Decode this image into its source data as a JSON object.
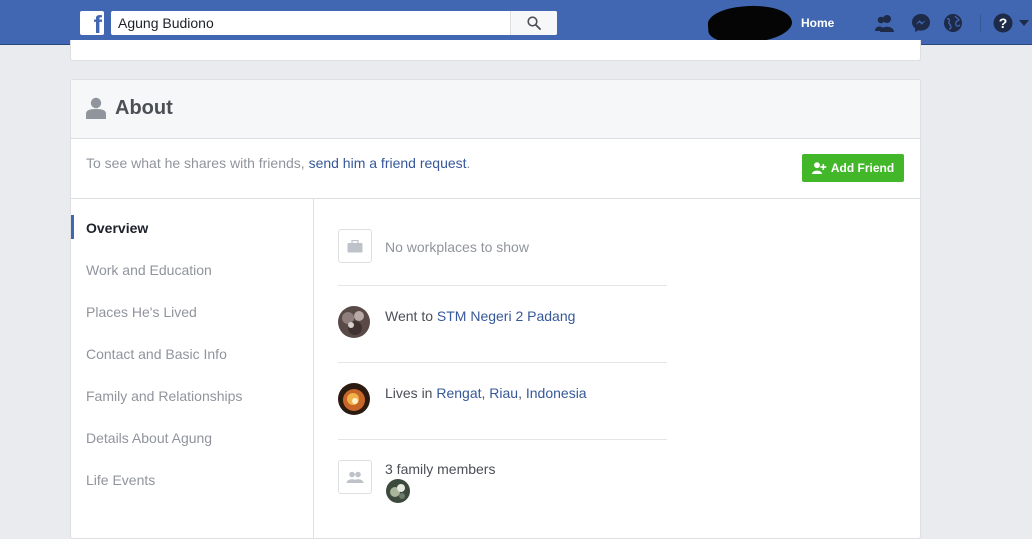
{
  "topbar": {
    "logo_letter": "f",
    "search_value": "Agung Budiono",
    "home_label": "Home"
  },
  "about": {
    "title": "About",
    "notice_prefix": "To see what he shares with friends, ",
    "notice_link": "send him a friend request",
    "notice_suffix": ".",
    "add_friend_label": "Add Friend"
  },
  "nav": {
    "items": [
      {
        "label": "Overview"
      },
      {
        "label": "Work and Education"
      },
      {
        "label": "Places He's Lived"
      },
      {
        "label": "Contact and Basic Info"
      },
      {
        "label": "Family and Relationships"
      },
      {
        "label": "Details About Agung"
      },
      {
        "label": "Life Events"
      }
    ]
  },
  "overview": {
    "work_text": "No workplaces to show",
    "school_prefix": "Went to ",
    "school_link": "STM Negeri 2 Padang",
    "lives_prefix": "Lives in ",
    "lives_city": "Rengat",
    "lives_sep1": ", ",
    "lives_region": "Riau",
    "lives_sep2": ", ",
    "lives_country": "Indonesia",
    "family_text": "3 family members"
  },
  "colors": {
    "brand_blue": "#4267b2",
    "add_friend_green": "#42b72a",
    "link_blue": "#365899"
  }
}
